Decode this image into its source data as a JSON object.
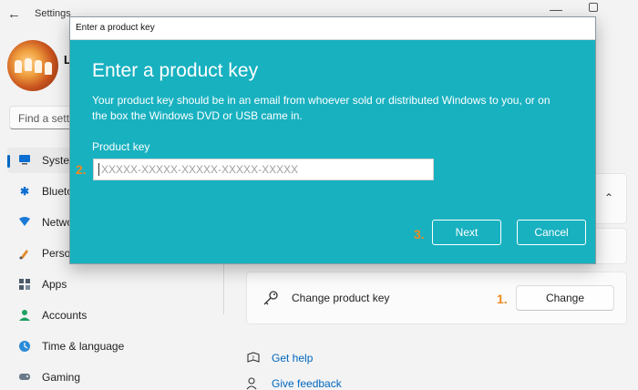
{
  "window": {
    "app_title": "Settings"
  },
  "user": {
    "name_initial": "L"
  },
  "search": {
    "placeholder": "Find a setti"
  },
  "sidebar": {
    "items": [
      {
        "label": "Syster",
        "icon": "monitor-icon",
        "active": true
      },
      {
        "label": "Blueto",
        "icon": "bluetooth-icon"
      },
      {
        "label": "Netwo",
        "icon": "wifi-icon"
      },
      {
        "label": "Perso",
        "icon": "pen-icon"
      },
      {
        "label": "Apps",
        "icon": "apps-icon"
      },
      {
        "label": "Accounts",
        "icon": "person-icon"
      },
      {
        "label": "Time & language",
        "icon": "globe-clock-icon"
      },
      {
        "label": "Gaming",
        "icon": "gamepad-icon"
      }
    ]
  },
  "main": {
    "product_key_row": {
      "label": "Change product key",
      "button": "Change",
      "step": "1."
    },
    "links": [
      {
        "text": "Get help",
        "icon": "help-icon"
      },
      {
        "text": "Give feedback",
        "icon": "feedback-icon"
      }
    ]
  },
  "dialog": {
    "window_title": "Enter a product key",
    "heading": "Enter a product key",
    "description": "Your product key should be in an email from whoever sold or distributed Windows to you, or on the box the Windows DVD or USB came in.",
    "field_label": "Product key",
    "input_placeholder": "XXXXX-XXXXX-XXXXX-XXXXX-XXXXX",
    "input_value": "",
    "step_input": "2.",
    "step_next": "3.",
    "next_button": "Next",
    "cancel_button": "Cancel"
  },
  "colors": {
    "dialog_accent": "#18b1c0",
    "step_marker": "#f08a1c",
    "link": "#0067c0"
  }
}
